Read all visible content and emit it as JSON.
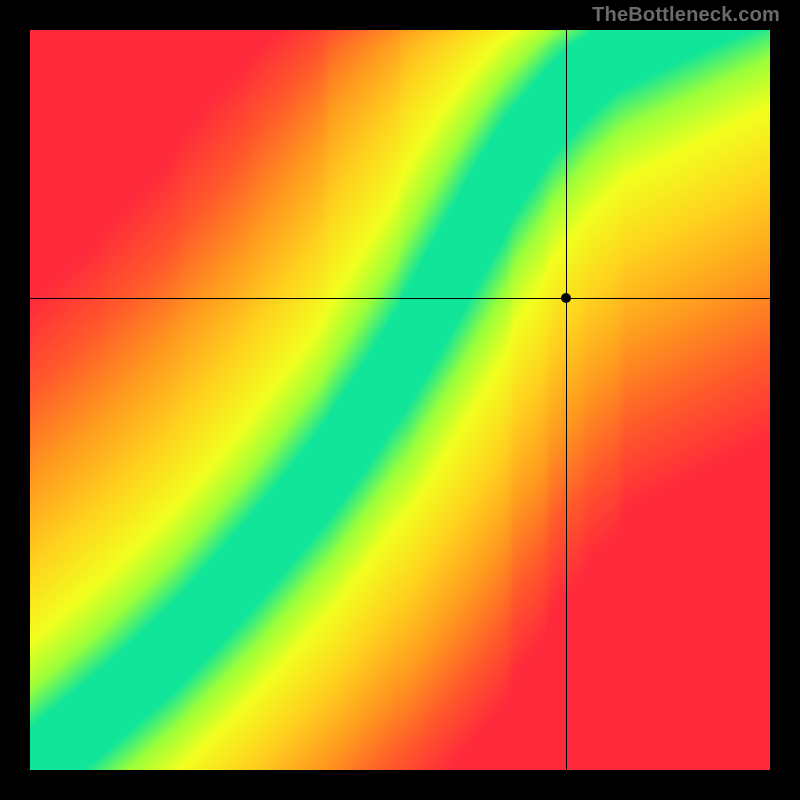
{
  "watermark": "TheBottleneck.com",
  "plot": {
    "canvas_left": 30,
    "canvas_top": 30,
    "canvas_size": 740,
    "marker": {
      "x_frac": 0.724,
      "y_frac": 0.362
    }
  },
  "chart_data": {
    "type": "heatmap",
    "title": "",
    "xlabel": "",
    "ylabel": "",
    "xlim": [
      0,
      100
    ],
    "ylim": [
      0,
      100
    ],
    "crosshair": {
      "x": 72.4,
      "y": 63.8
    },
    "marker_point": {
      "x": 72.4,
      "y": 63.8
    },
    "ridge_curve": [
      {
        "x": 0,
        "y": 0
      },
      {
        "x": 10,
        "y": 8
      },
      {
        "x": 20,
        "y": 17
      },
      {
        "x": 30,
        "y": 28
      },
      {
        "x": 40,
        "y": 40
      },
      {
        "x": 50,
        "y": 55
      },
      {
        "x": 55,
        "y": 64
      },
      {
        "x": 60,
        "y": 73
      },
      {
        "x": 65,
        "y": 82
      },
      {
        "x": 70,
        "y": 89
      },
      {
        "x": 75,
        "y": 94
      },
      {
        "x": 80,
        "y": 98
      },
      {
        "x": 85,
        "y": 100
      }
    ],
    "ridge_width": 6,
    "color_stops": [
      {
        "t": 0.0,
        "color": "#ff2a3b"
      },
      {
        "t": 0.2,
        "color": "#ff5a2a"
      },
      {
        "t": 0.4,
        "color": "#ff9a1e"
      },
      {
        "t": 0.6,
        "color": "#ffd21e"
      },
      {
        "t": 0.78,
        "color": "#f2ff1e"
      },
      {
        "t": 0.9,
        "color": "#9bff3a"
      },
      {
        "t": 1.0,
        "color": "#11e59a"
      }
    ]
  }
}
